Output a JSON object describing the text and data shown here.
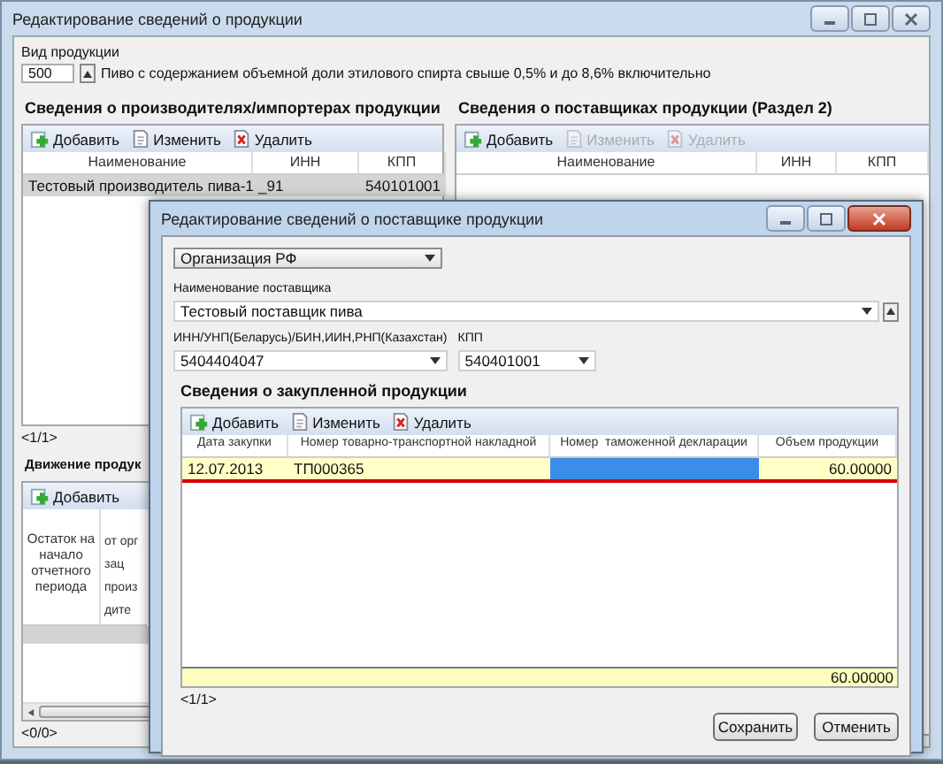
{
  "window": {
    "title": "Редактирование сведений о продукции"
  },
  "product_type": {
    "label": "Вид продукции",
    "code": "500",
    "description": "Пиво с содержанием объемной доли этилового спирта свыше 0,5% и до 8,6% включительно"
  },
  "producers": {
    "title": "Сведения о производителях/импортерах продукции",
    "toolbar": [
      {
        "kind": "add",
        "label": "Добавить",
        "disabled": false
      },
      {
        "kind": "edit",
        "label": "Изменить",
        "disabled": false
      },
      {
        "kind": "delete",
        "label": "Удалить",
        "disabled": false
      }
    ],
    "columns": [
      "Наименование",
      "ИНН",
      "КПП"
    ],
    "rows": [
      {
        "cells": [
          "Тестовый производитель пива-1",
          "_91",
          "540101001"
        ],
        "selected": true
      }
    ],
    "pager": "<1/1>"
  },
  "suppliers": {
    "title": "Сведения о поставщиках продукции (Раздел 2)",
    "toolbar": [
      {
        "kind": "add",
        "label": "Добавить",
        "disabled": false
      },
      {
        "kind": "edit",
        "label": "Изменить",
        "disabled": true
      },
      {
        "kind": "delete",
        "label": "Удалить",
        "disabled": true
      }
    ],
    "columns": [
      "Наименование",
      "ИНН",
      "КПП"
    ]
  },
  "movement": {
    "title": "Движение продук",
    "toolbar": [
      {
        "kind": "add",
        "label": "Добавить",
        "disabled": false
      }
    ],
    "columns": [
      "Остаток на начало отчетного периода",
      "от орг\nзац\nпроиз\nдите"
    ],
    "pager": "<0/0>"
  },
  "dialog": {
    "title": "Редактирование сведений о поставщике продукции",
    "org_type": "Организация РФ",
    "supplier_name": {
      "label": "Наименование поставщика",
      "value": "Тестовый поставщик пива"
    },
    "inn": {
      "label": "ИНН/УНП(Беларусь)/БИН,ИИН,РНП(Казахстан)",
      "value": "5404404047"
    },
    "kpp": {
      "label": "КПП",
      "value": "540401001"
    },
    "purchases": {
      "title": "Сведения о закупленной продукции",
      "toolbar": [
        {
          "kind": "add",
          "label": "Добавить",
          "disabled": false
        },
        {
          "kind": "edit",
          "label": "Изменить",
          "disabled": false
        },
        {
          "kind": "delete",
          "label": "Удалить",
          "disabled": false
        }
      ],
      "columns": [
        "Дата закупки",
        "Номер товарно-транспортной накладной",
        "Номер  таможенной декларации",
        "Объем продукции"
      ],
      "rows": [
        {
          "selected": true,
          "cells": [
            {
              "text": "12.07.2013"
            },
            {
              "text": "ТП000365"
            },
            {
              "focused": true
            },
            {
              "text": "60.00000"
            }
          ]
        }
      ],
      "total": "60.00000",
      "pager": "<1/1>"
    },
    "buttons": [
      "Сохранить",
      "Отменить"
    ]
  }
}
